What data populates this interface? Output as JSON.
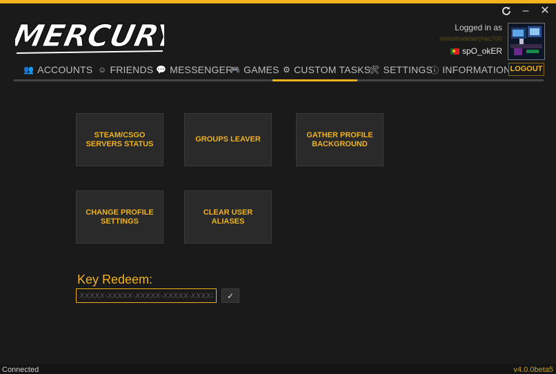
{
  "app": {
    "logo_text": "MERCURY",
    "accent_color": "#f0b31e"
  },
  "window_controls": {
    "refresh_icon": "refresh-icon",
    "minimize_label": "–",
    "close_label": "✕"
  },
  "user": {
    "logged_in_label": "Logged in as",
    "email": "monstrodetarchac700",
    "username": "spO_okER",
    "flag_icon": "portugal-flag-icon"
  },
  "nav": {
    "tabs": [
      {
        "label": "ACCOUNTS",
        "icon": "users-icon",
        "glyph": "👥"
      },
      {
        "label": "FRIENDS",
        "icon": "smiley-icon",
        "glyph": "☺"
      },
      {
        "label": "MESSENGER",
        "icon": "chat-bubble-icon",
        "glyph": "💬"
      },
      {
        "label": "GAMES",
        "icon": "gamepad-icon",
        "glyph": "🎮"
      },
      {
        "label": "CUSTOM TASKS",
        "icon": "gear-icon",
        "glyph": "⚙"
      },
      {
        "label": "SETTINGS",
        "icon": "tools-icon",
        "glyph": "🛠"
      },
      {
        "label": "INFORMATION",
        "icon": "info-icon",
        "glyph": "ⓘ"
      }
    ],
    "active_tab": "CUSTOM TASKS",
    "logout_label": "LOGOUT"
  },
  "tasks": [
    "STEAM/CSGO SERVERS STATUS",
    "GROUPS LEAVER",
    "GATHER PROFILE BACKGROUND",
    "CHANGE PROFILE SETTINGS",
    "CLEAR USER ALIASES"
  ],
  "key_redeem": {
    "label": "Key Redeem:",
    "placeholder": "XXXXX-XXXXX-XXXXX-XXXXX-XXXXX",
    "value": "",
    "submit_label": "✓"
  },
  "status": {
    "text": "Connected",
    "version": "v4.0.0beta5"
  }
}
